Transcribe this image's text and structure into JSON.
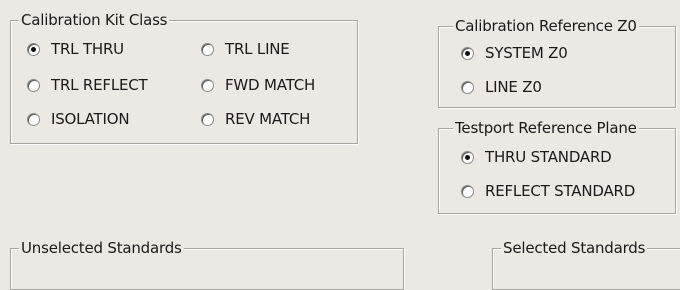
{
  "calibration_kit_class": {
    "title": "Calibration Kit Class",
    "options": [
      {
        "label": "TRL THRU",
        "selected": true
      },
      {
        "label": "TRL LINE",
        "selected": false
      },
      {
        "label": "TRL REFLECT",
        "selected": false
      },
      {
        "label": "FWD MATCH",
        "selected": false
      },
      {
        "label": "ISOLATION",
        "selected": false
      },
      {
        "label": "REV MATCH",
        "selected": false
      }
    ]
  },
  "calibration_reference_z0": {
    "title": "Calibration Reference Z0",
    "options": [
      {
        "label": "SYSTEM Z0",
        "selected": true
      },
      {
        "label": "LINE Z0",
        "selected": false
      }
    ]
  },
  "testport_reference_plane": {
    "title": "Testport Reference Plane",
    "options": [
      {
        "label": "THRU STANDARD",
        "selected": true
      },
      {
        "label": "REFLECT STANDARD",
        "selected": false
      }
    ]
  },
  "unselected_standards": {
    "title": "Unselected Standards"
  },
  "selected_standards": {
    "title": "Selected Standards"
  }
}
